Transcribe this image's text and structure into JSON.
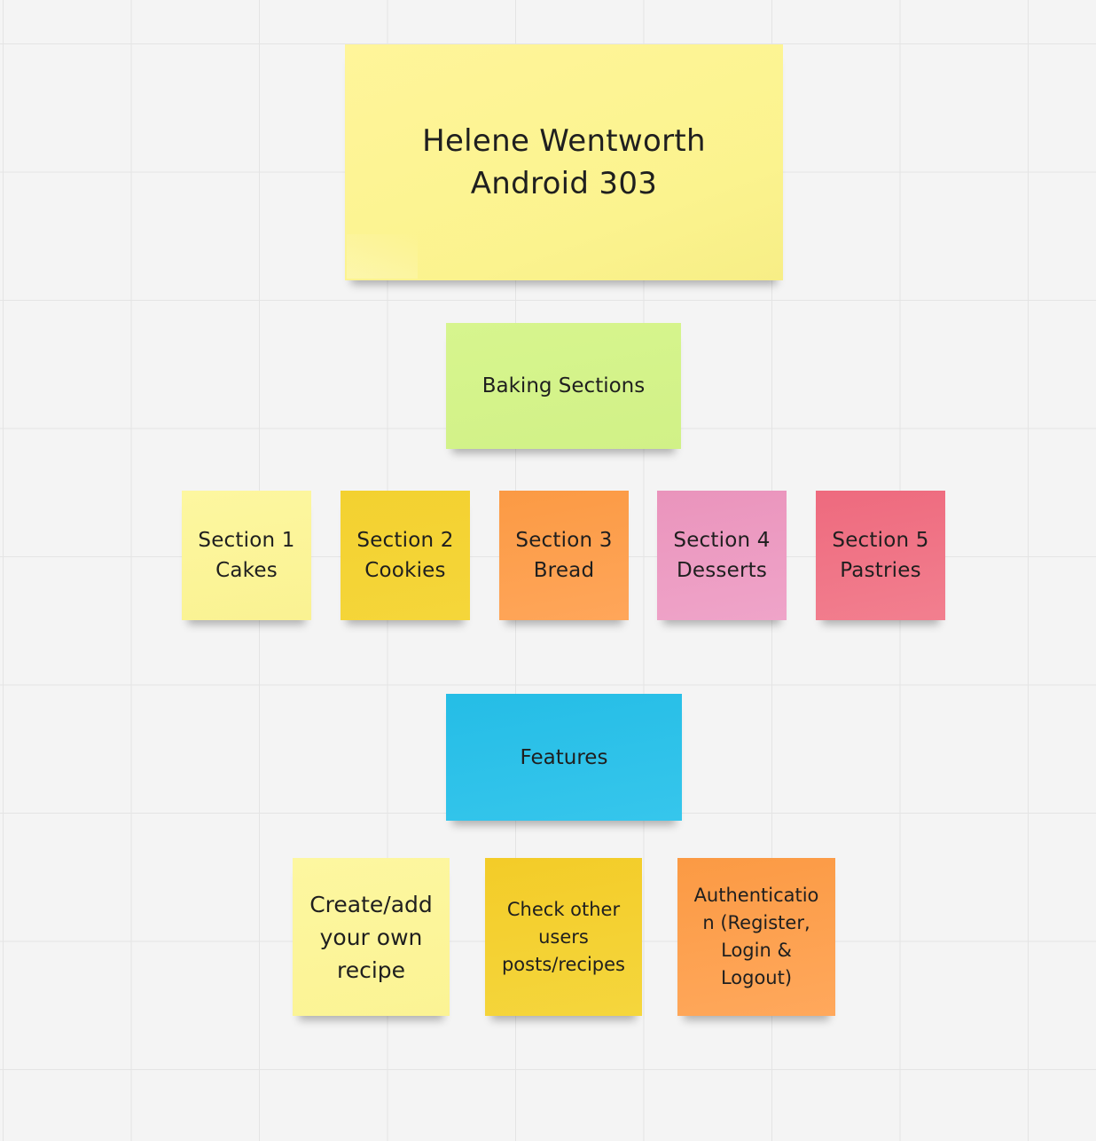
{
  "board": {
    "title_note": {
      "text": "Helene Wentworth\nAndroid 303",
      "color": "#fbf38e"
    },
    "baking_note": {
      "text": "Baking Sections",
      "color": "#d3f38a"
    },
    "sections": [
      {
        "text": "Section 1\nCakes",
        "color": "#fbf496"
      },
      {
        "text": "Section 2\nCookies",
        "color": "#f4d334"
      },
      {
        "text": "Section 3\nBread",
        "color": "#fda050"
      },
      {
        "text": "Section 4\nDesserts",
        "color": "#ec9cc2"
      },
      {
        "text": "Section 5\nPastries",
        "color": "#f07487"
      }
    ],
    "features_note": {
      "text": "Features",
      "color": "#2ec2ea"
    },
    "features": [
      {
        "text": "Create/add\nyour own\nrecipe",
        "color": "#fcf59a"
      },
      {
        "text": "Check other\nusers\nposts/recipes",
        "color": "#f4d134"
      },
      {
        "text": "Authenticatio\nn (Register,\nLogin &\nLogout)",
        "color": "#fda050"
      }
    ]
  }
}
